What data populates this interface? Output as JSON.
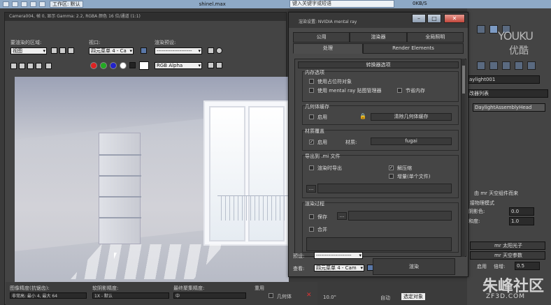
{
  "topbar": {
    "workspace": "工作区: 默认",
    "file": "shinel.max",
    "search_placeholder": "键入关键字或短语",
    "net_speed": "0KB/S"
  },
  "render_window": {
    "title": "Camera004, 帧 0, 显示 Gamma: 2.2, RGBA 颜色 16 位/通道 (1:1)",
    "area_label": "要渲染的区域:",
    "area_value": "视图",
    "viewport_label": "视口:",
    "viewport_value": "四元菜单 4 - Ca",
    "preset_label": "渲染预设:",
    "preset_value": "--------------------",
    "channel_value": "RGB Alpha"
  },
  "render_status": {
    "image_precision_label": "图像精度(抗锯齿):",
    "image_precision_value": "非常高: 最小 4, 最大 64",
    "soft_shadow_label": "软阴影精度:",
    "soft_shadow_value": "1X - 默认",
    "final_gather_label": "最终聚集精度:",
    "final_gather_value": "中",
    "reuse_label": "重用",
    "geometry_label": "几何体"
  },
  "dialog": {
    "title": "渲染设置: NVIDIA mental ray",
    "tabs_row1": [
      "公用",
      "渲染器",
      "全局照明"
    ],
    "tabs_row2": [
      "处理",
      "Render Elements"
    ],
    "rollout": "转换器选项",
    "memory_group": "内存选项",
    "use_placeholder": "使用占位符对象",
    "use_mr_map_manager": "使用 mental ray 贴图管理器",
    "conserve_memory": "节省内存",
    "geometry_cache_group": "几何体缓存",
    "enable": "启用",
    "clear_geometry_cache": "清除几何体缓存",
    "material_override_group": "材质覆盖",
    "material_label": "材质:",
    "material_value": "fugai",
    "export_mi_group": "导出到 .mi 文件",
    "export_on_render": "渲染时导出",
    "compressed": "解压缩",
    "increment": "增量(单个文件)",
    "browse": "...",
    "render_pass_group": "渲染过程",
    "save": "保存",
    "merge": "合并",
    "preset_label": "预设:",
    "preset_value": "--------------------",
    "view_label": "查看:",
    "view_value": "四元菜单 4 - Cam",
    "render_button": "渲染"
  },
  "command_panel": {
    "object_name": "aylight001",
    "modifier_list": "改器列表",
    "modifier_item": "DaylightAssemblyHead",
    "mr_sky_label": "由 mr 天空组件而来",
    "physical_label": "接物理模式",
    "shadow_label": "阴影色:",
    "shadow_value": "0.0",
    "saturation_label": "和度:",
    "saturation_value": "1.0",
    "mr_sun_photons": "mr 太阳光子",
    "mr_sky_params": "mr 天空参数",
    "enable_label": "启用",
    "multiplier_label": "倍增:",
    "multiplier_value": "0.5"
  },
  "bottom_mid": {
    "zoom": "10.0\"",
    "auto_key": "自动",
    "selected": "选定对象"
  },
  "watermarks": {
    "youku": "YOUKU",
    "youku_cn": "优酷",
    "site": "朱峰社区",
    "site_url": "ZF3D.COM"
  }
}
